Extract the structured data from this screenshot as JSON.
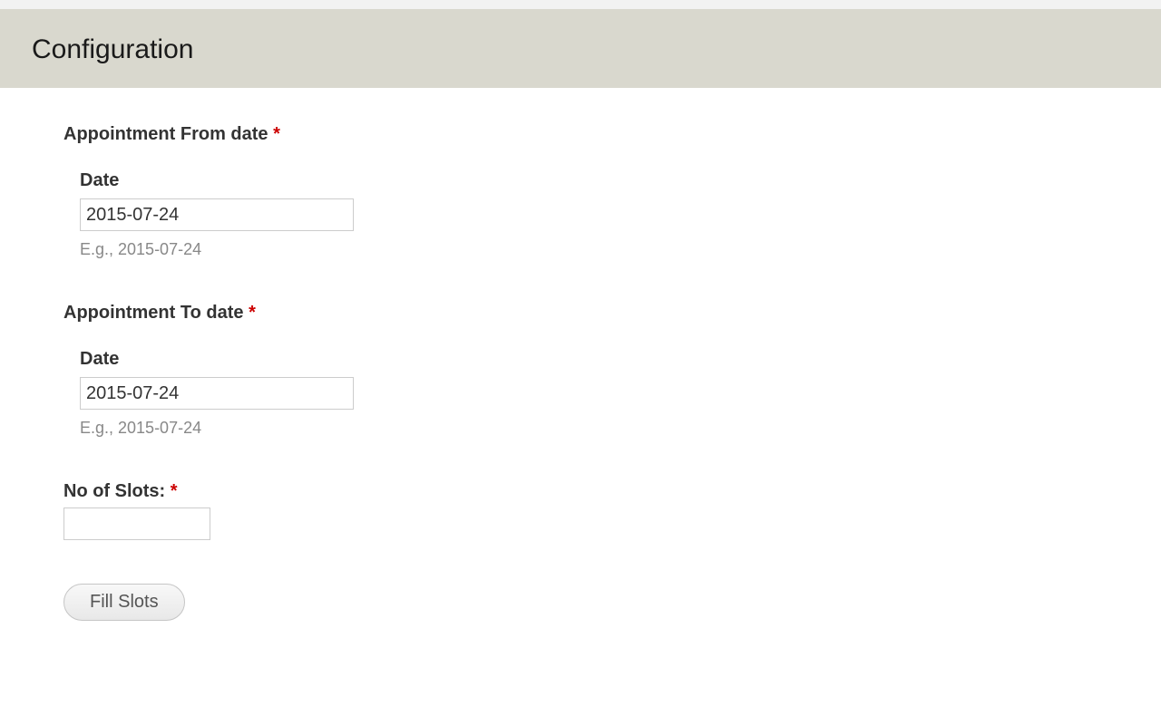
{
  "header": {
    "title": "Configuration"
  },
  "form": {
    "from_date": {
      "label": "Appointment From date ",
      "sub_label": "Date",
      "value": "2015-07-24",
      "hint": "E.g., 2015-07-24"
    },
    "to_date": {
      "label": "Appointment To date ",
      "sub_label": "Date",
      "value": "2015-07-24",
      "hint": "E.g., 2015-07-24"
    },
    "slots": {
      "label": "No of Slots: ",
      "value": ""
    },
    "required_marker": "*",
    "submit_label": "Fill Slots"
  }
}
